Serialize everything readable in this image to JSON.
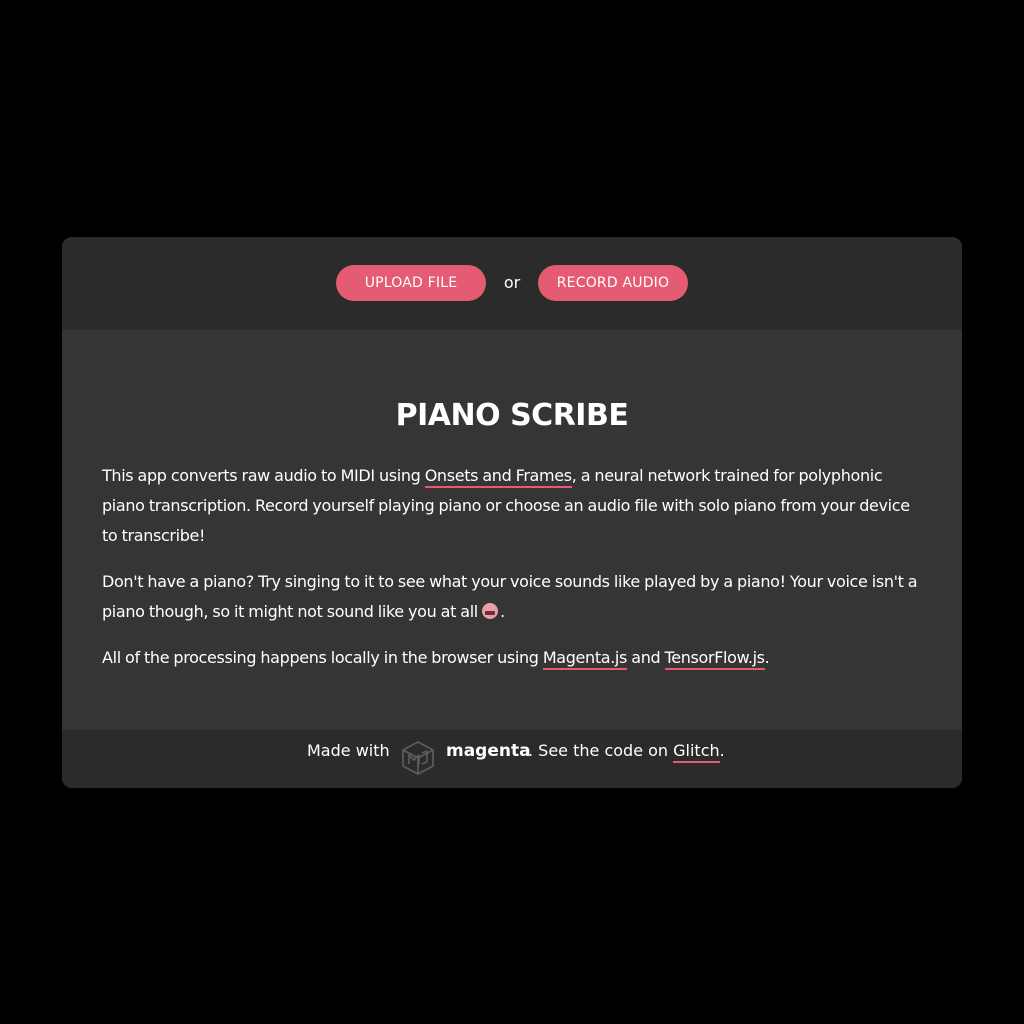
{
  "controls": {
    "upload_label": "UPLOAD FILE",
    "separator": "or",
    "record_label": "RECORD AUDIO"
  },
  "intro": {
    "title": "PIANO SCRIBE",
    "p1_before": "This app converts raw audio to MIDI using ",
    "p1_link": "Onsets and Frames",
    "p1_after": ", a neural network trained for polyphonic piano transcription. Record yourself playing piano or choose an audio file with solo piano from your device to transcribe!",
    "p2_text": "Don't have a piano? Try singing to it to see what your voice sounds like played by a piano! Your voice isn't a piano though, so it might not sound like you at all ",
    "p2_end": ".",
    "p3_before": "All of the processing happens locally in the browser using ",
    "p3_link1": "Magenta.js",
    "p3_mid": " and ",
    "p3_link2": "TensorFlow.js",
    "p3_after": "."
  },
  "footer": {
    "made_with": "Made with",
    "brand": "magenta",
    "code_text": ". See the code on ",
    "code_link": "Glitch",
    "end": "."
  },
  "colors": {
    "accent": "#e55b74",
    "panel_dark": "#2b2b2b",
    "panel_mid": "#353535",
    "background": "#000000"
  },
  "icons": {
    "brand_logo": "magenta-logo-icon",
    "emoji": "grimacing-face-icon"
  }
}
